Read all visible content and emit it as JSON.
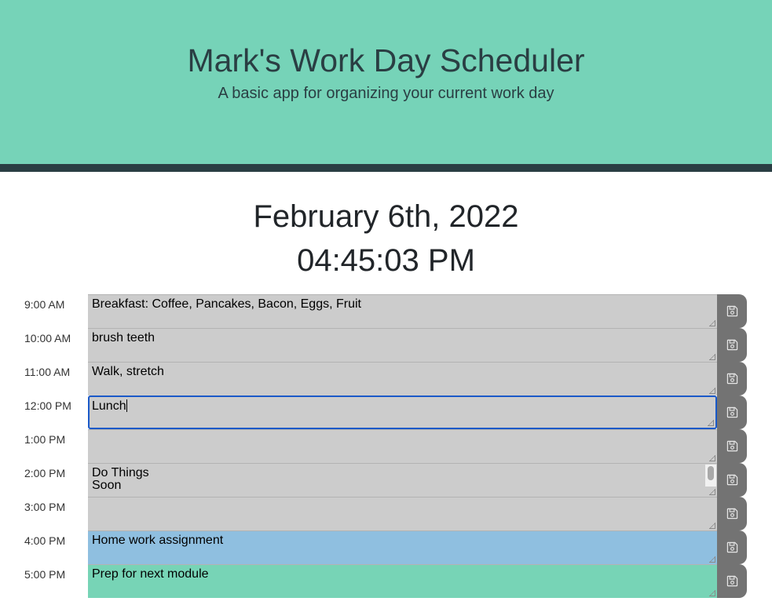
{
  "header": {
    "title": "Mark's Work Day Scheduler",
    "subtitle": "A basic app for organizing your current work day"
  },
  "current": {
    "date": "February 6th, 2022",
    "time": "04:45:03 PM"
  },
  "colors": {
    "past": "#cccccc",
    "present": "#8fbfe0",
    "future": "#77d4b6",
    "header_bg": "#76d3b8",
    "header_border": "#2a3e43",
    "save_button": "#737373"
  },
  "save_icon": "floppy-disk-icon",
  "hours": [
    {
      "label": "9:00 AM",
      "task": "Breakfast: Coffee, Pancakes, Bacon, Eggs, Fruit",
      "state": "past"
    },
    {
      "label": "10:00 AM",
      "task": "brush teeth",
      "state": "past"
    },
    {
      "label": "11:00 AM",
      "task": "Walk, stretch",
      "state": "past"
    },
    {
      "label": "12:00 PM",
      "task": "Lunch",
      "state": "past",
      "focused": true
    },
    {
      "label": "1:00 PM",
      "task": "",
      "state": "past"
    },
    {
      "label": "2:00 PM",
      "task": "Do Things\nSoon",
      "state": "past",
      "scroll": true
    },
    {
      "label": "3:00 PM",
      "task": "",
      "state": "past"
    },
    {
      "label": "4:00 PM",
      "task": "Home work assignment",
      "state": "present"
    },
    {
      "label": "5:00 PM",
      "task": "Prep for next module",
      "state": "future"
    }
  ]
}
